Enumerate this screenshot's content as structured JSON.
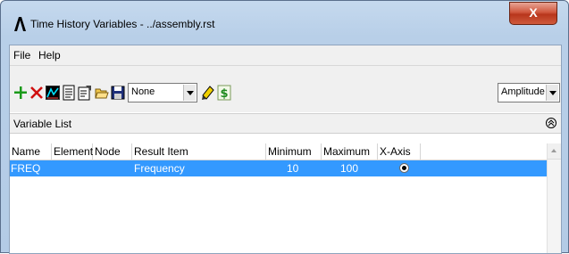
{
  "window": {
    "title": "Time History Variables - ../assembly.rst",
    "close_label": "X"
  },
  "menu": {
    "items": [
      "File",
      "Help"
    ]
  },
  "toolbar": {
    "icons": [
      "add-variable-icon",
      "delete-variable-icon",
      "graph-icon",
      "list-icon",
      "properties-icon",
      "open-folder-icon",
      "save-icon",
      "calculator-icon",
      "dollar-icon"
    ],
    "variable_combo_value": "None",
    "display_combo_value": "Amplitude"
  },
  "variable_list": {
    "header": "Variable List",
    "columns": [
      "Name",
      "Element",
      "Node",
      "Result Item",
      "Minimum",
      "Maximum",
      "X-Axis"
    ],
    "rows": [
      {
        "name": "FREQ",
        "element": "",
        "node": "",
        "result_item": "Frequency",
        "minimum": "10",
        "maximum": "100",
        "x_axis": true
      }
    ]
  },
  "colors": {
    "selection": "#3399ff",
    "close_button": "#c94a2f",
    "frame": "#b8cfe8"
  }
}
